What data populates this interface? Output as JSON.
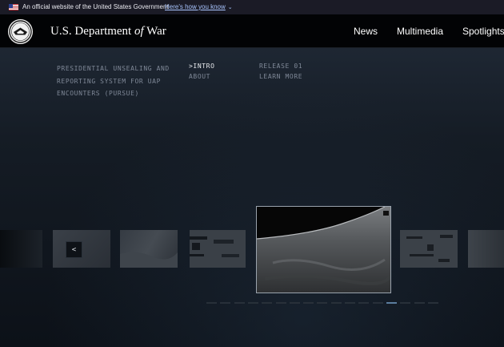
{
  "gov_banner": {
    "text": "An official website of the United States Government",
    "link": "Here's how you know"
  },
  "header": {
    "title_prefix": "U.S. Department ",
    "title_of": "of",
    "title_suffix": " War",
    "nav": [
      "News",
      "Multimedia",
      "Spotlights"
    ]
  },
  "hero": {
    "program_title": "PRESIDENTIAL UNSEALING AND REPORTING SYSTEM FOR UAP ENCOUNTERS (PURSUE)",
    "links": {
      "intro": ">INTRO",
      "about": "ABOUT",
      "release": "RELEASE 01",
      "learn_more": "LEARN MORE"
    }
  },
  "carousel": {
    "prev_label": "<",
    "active_page": 13,
    "page_count": 17
  },
  "colors": {
    "gov_banner_bg": "#1b1b26",
    "header_bg": "#020305",
    "hero_bg": "#151c25",
    "accent": "#5b7d9e"
  }
}
